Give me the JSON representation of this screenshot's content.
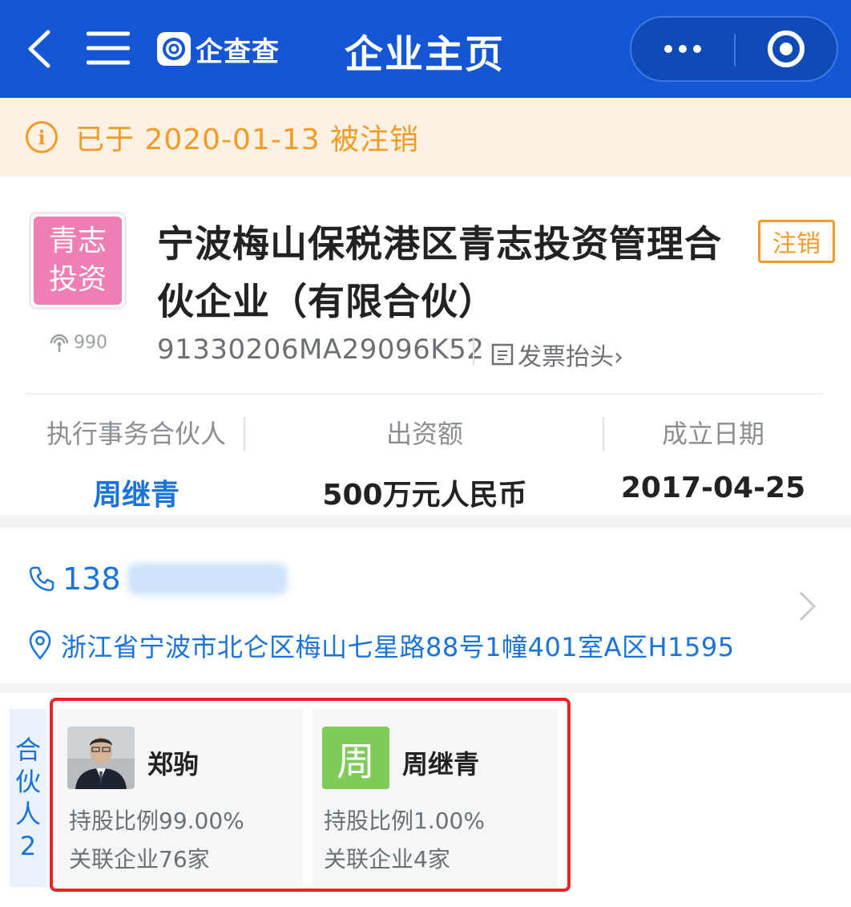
{
  "header": {
    "logo_text": "企查查",
    "title": "企业主页"
  },
  "notice": {
    "text": "已于 2020-01-13 被注销",
    "icon": "info-icon"
  },
  "company": {
    "logo_line1": "青志",
    "logo_line2": "投资",
    "heat": "990",
    "name": "宁波梅山保税港区青志投资管理合伙企业（有限合伙）",
    "status": "注销",
    "credit_code": "91330206MA29096K52",
    "invoice_label": "发票抬头›",
    "stats": [
      {
        "label": "执行事务合伙人",
        "value": "周继青"
      },
      {
        "label": "出资额",
        "value": "500万元人民币"
      },
      {
        "label": "成立日期",
        "value": "2017-04-25"
      }
    ]
  },
  "contact": {
    "phone_prefix": "138",
    "address": "浙江省宁波市北仑区梅山七星路88号1幢401室A区H1595"
  },
  "partners": {
    "tab_chars": [
      "合",
      "伙",
      "人",
      "2"
    ],
    "items": [
      {
        "name": "郑驹",
        "share": "持股比例99.00%",
        "related": "关联企业76家",
        "avatar_type": "photo"
      },
      {
        "name": "周继青",
        "avatar_text": "周",
        "share": "持股比例1.00%",
        "related": "关联企业4家",
        "avatar_type": "text"
      }
    ]
  },
  "colors": {
    "header_bg": "#1456d6",
    "notice_bg": "#fdf1e3",
    "notice_text": "#f39b26",
    "link_blue": "#1a73d9",
    "highlight_red": "#e8242a"
  }
}
